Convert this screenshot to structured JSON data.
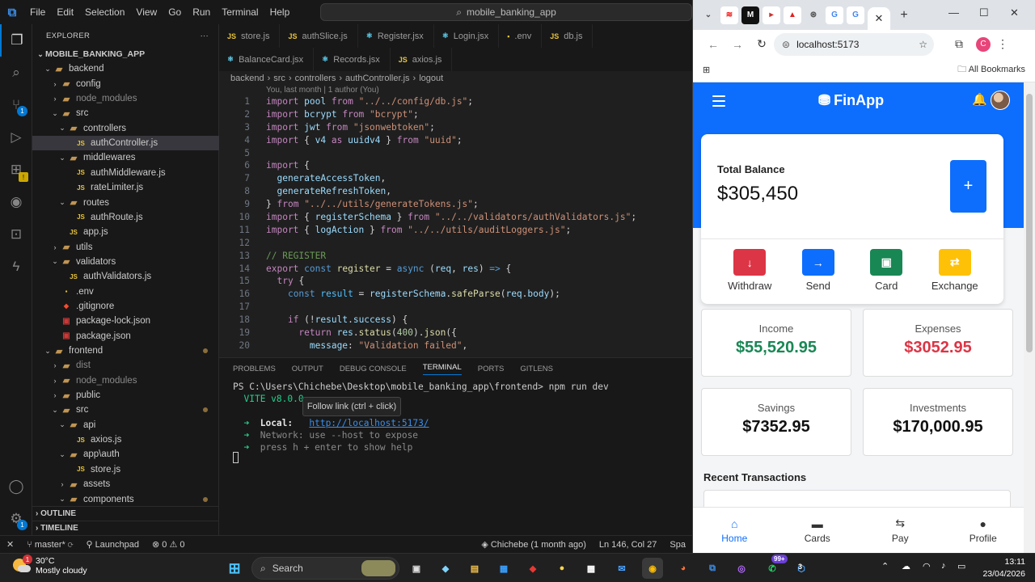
{
  "vscode": {
    "menu": [
      "File",
      "Edit",
      "Selection",
      "View",
      "Go",
      "Run",
      "Terminal",
      "Help"
    ],
    "command_center": "mobile_banking_app",
    "explorer_title": "EXPLORER",
    "explorer_more": "···",
    "tree": [
      {
        "label": "MOBILE_BANKING_APP",
        "depth": 0,
        "kind": "root",
        "open": true
      },
      {
        "label": "backend",
        "depth": 1,
        "kind": "folder",
        "open": true
      },
      {
        "label": "config",
        "depth": 2,
        "kind": "folder",
        "open": false
      },
      {
        "label": "node_modules",
        "depth": 2,
        "kind": "folder",
        "open": false,
        "dim": true
      },
      {
        "label": "src",
        "depth": 2,
        "kind": "folder",
        "open": true
      },
      {
        "label": "controllers",
        "depth": 3,
        "kind": "folder",
        "open": true
      },
      {
        "label": "authController.js",
        "depth": 4,
        "kind": "js",
        "selected": true
      },
      {
        "label": "middlewares",
        "depth": 3,
        "kind": "folder",
        "open": true
      },
      {
        "label": "authMiddleware.js",
        "depth": 4,
        "kind": "js"
      },
      {
        "label": "rateLimiter.js",
        "depth": 4,
        "kind": "js"
      },
      {
        "label": "routes",
        "depth": 3,
        "kind": "folder",
        "open": true
      },
      {
        "label": "authRoute.js",
        "depth": 4,
        "kind": "js"
      },
      {
        "label": "app.js",
        "depth": 3,
        "kind": "js"
      },
      {
        "label": "utils",
        "depth": 2,
        "kind": "folder",
        "open": false
      },
      {
        "label": "validators",
        "depth": 2,
        "kind": "folder",
        "open": true
      },
      {
        "label": "authValidators.js",
        "depth": 3,
        "kind": "js"
      },
      {
        "label": ".env",
        "depth": 2,
        "kind": "env"
      },
      {
        "label": ".gitignore",
        "depth": 2,
        "kind": "git"
      },
      {
        "label": "package-lock.json",
        "depth": 2,
        "kind": "pkg"
      },
      {
        "label": "package.json",
        "depth": 2,
        "kind": "pkg"
      },
      {
        "label": "frontend",
        "depth": 1,
        "kind": "folder",
        "open": true,
        "dot": true
      },
      {
        "label": "dist",
        "depth": 2,
        "kind": "folder",
        "open": false,
        "dim": true
      },
      {
        "label": "node_modules",
        "depth": 2,
        "kind": "folder",
        "open": false,
        "dim": true
      },
      {
        "label": "public",
        "depth": 2,
        "kind": "folder",
        "open": false
      },
      {
        "label": "src",
        "depth": 2,
        "kind": "folder",
        "open": true,
        "dot": true
      },
      {
        "label": "api",
        "depth": 3,
        "kind": "folder",
        "open": true
      },
      {
        "label": "axios.js",
        "depth": 4,
        "kind": "js"
      },
      {
        "label": "app\\auth",
        "depth": 3,
        "kind": "folder",
        "open": true
      },
      {
        "label": "store.js",
        "depth": 4,
        "kind": "js"
      },
      {
        "label": "assets",
        "depth": 3,
        "kind": "folder",
        "open": false
      },
      {
        "label": "components",
        "depth": 3,
        "kind": "folder",
        "open": true,
        "dot": true
      }
    ],
    "outline": "OUTLINE",
    "timeline": "TIMELINE",
    "tabs_row1": [
      {
        "label": "store.js",
        "icon": "JS"
      },
      {
        "label": "authSlice.js",
        "icon": "JS"
      },
      {
        "label": "Register.jsx",
        "icon": "⚛"
      },
      {
        "label": "Login.jsx",
        "icon": "⚛"
      },
      {
        "label": ".env",
        "icon": "▪"
      },
      {
        "label": "db.js",
        "icon": "JS"
      }
    ],
    "tabs_row2": [
      {
        "label": "BalanceCard.jsx",
        "icon": "⚛"
      },
      {
        "label": "Records.jsx",
        "icon": "⚛"
      },
      {
        "label": "axios.js",
        "icon": "JS"
      }
    ],
    "breadcrumb": [
      "backend",
      "src",
      "controllers",
      "authController.js",
      "logout"
    ],
    "blame": "You, last month | 1 author (You)",
    "code_lines": [
      "1",
      "2",
      "3",
      "4",
      "5",
      "6",
      "7",
      "8",
      "9",
      "10",
      "11",
      "12",
      "13",
      "14",
      "15",
      "16",
      "17",
      "18",
      "19",
      "20"
    ],
    "panel_tabs": [
      "PROBLEMS",
      "OUTPUT",
      "DEBUG CONSOLE",
      "TERMINAL",
      "PORTS",
      "GITLENS"
    ],
    "terminal": {
      "prompt": "PS C:\\Users\\Chichebe\\Desktop\\mobile_banking_app\\frontend> npm run dev",
      "vite": "VITE v8.0.0",
      "local_label": "Local:",
      "local_url": "http://localhost:5173/",
      "network": "Network: use --host to expose",
      "help": "press h + enter to show help"
    },
    "tooltip": "Follow link (ctrl + click)",
    "status": {
      "branch": "master*",
      "launchpad": "Launchpad",
      "problems": "⊗ 0 ⚠ 0",
      "blame": "Chichebe (1 month ago)",
      "position": "Ln 146, Col 27",
      "spaces": "Spa"
    }
  },
  "chrome": {
    "url": "localhost:5173",
    "bookmarks": "All Bookmarks",
    "profile_initial": "C"
  },
  "finapp": {
    "brand": "FinApp",
    "balance_label": "Total Balance",
    "balance": "$305,450",
    "add_symbol": "+",
    "actions": [
      {
        "label": "Withdraw",
        "icon": "arrow-down-icon",
        "glyph": "↓",
        "color": "#dc3545"
      },
      {
        "label": "Send",
        "icon": "arrow-right-icon",
        "glyph": "→",
        "color": "#0d6efd"
      },
      {
        "label": "Card",
        "icon": "card-icon",
        "glyph": "▣",
        "color": "#198754"
      },
      {
        "label": "Exchange",
        "icon": "exchange-icon",
        "glyph": "⇄",
        "color": "#ffc107"
      }
    ],
    "stats": [
      {
        "label": "Income",
        "value": "$55,520.95",
        "color": "#198754"
      },
      {
        "label": "Expenses",
        "value": "$3052.95",
        "color": "#dc3545"
      },
      {
        "label": "Savings",
        "value": "$7352.95",
        "color": "#111111"
      },
      {
        "label": "Investments",
        "value": "$170,000.95",
        "color": "#111111"
      }
    ],
    "recent_title": "Recent Transactions",
    "nav": [
      {
        "label": "Home",
        "icon": "home-icon",
        "glyph": "⌂"
      },
      {
        "label": "Cards",
        "icon": "cards-icon",
        "glyph": "▬"
      },
      {
        "label": "Pay",
        "icon": "pay-icon",
        "glyph": "⇆"
      },
      {
        "label": "Profile",
        "icon": "profile-icon",
        "glyph": "●"
      }
    ]
  },
  "taskbar": {
    "temp": "30°C",
    "weather": "Mostly cloudy",
    "weather_badge": "1",
    "search": "Search",
    "notif_badge": "99+",
    "vpn_badge": "3",
    "time": "13:11",
    "date": "23/04/2026"
  }
}
